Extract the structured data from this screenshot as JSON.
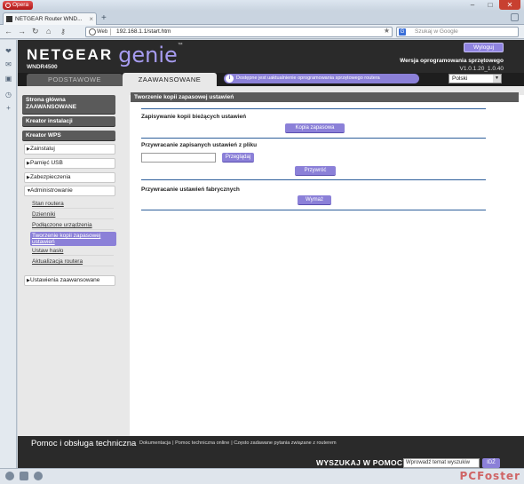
{
  "browser": {
    "app_button": "Opera",
    "tab_title": "NETGEAR Router WND...",
    "web_badge": "Web",
    "url": "192.168.1.1/start.htm",
    "search_placeholder": "Szukaj w Google"
  },
  "header": {
    "brand": "NETGEAR",
    "product": "genie",
    "model": "WNDR4500",
    "logout": "Wyloguj",
    "firmware_label": "Wersja oprogramowania sprzętowego",
    "firmware_version": "V1.0.1.20_1.0.40"
  },
  "tabs": {
    "basic": "PODSTAWOWE",
    "advanced": "ZAAWANSOWANE",
    "update_notice": "Dostępne jest uaktualnienie oprogramowania sprzętowego routera",
    "language": "Polski"
  },
  "nav": {
    "home": "Strona główna ZAAWANSOWANE",
    "setup_wizard": "Kreator instalacji",
    "wps_wizard": "Kreator WPS",
    "setup": "Zainstaluj",
    "usb_storage": "Pamięć USB",
    "security": "Zabezpieczenia",
    "administration": "Administrowanie",
    "sub": {
      "router_status": "Stan routera",
      "logs": "Dzienniki",
      "attached_devices": "Podłączone urządzenia",
      "backup": "Tworzenie kopii zapasowej ustawień",
      "set_password": "Ustaw hasło",
      "router_update": "Aktualizacja routera"
    },
    "advanced_setup": "Ustawienia zaawansowane"
  },
  "content": {
    "title": "Tworzenie kopii zapasowej ustawień",
    "save_label": "Zapisywanie kopii bieżących ustawień",
    "backup_button": "Kopia zapasowa",
    "restore_label": "Przywracanie zapisanych ustawień z pliku",
    "browse_button": "Przeglądaj",
    "restore_button": "Przywróć",
    "factory_label": "Przywracanie ustawień fabrycznych",
    "erase_button": "Wymaż"
  },
  "footer": {
    "help_title": "Pomoc i obsługa techniczna",
    "links": [
      "Dokumentacja",
      "Pomoc techniczna online",
      "Często zadawane pytania związane z routerem"
    ],
    "search_label": "WYSZUKAJ W POMOCY",
    "search_placeholder": "Wprowadź temat wyszukiw",
    "search_button": "IDŹ"
  },
  "watermark": "PCFoster"
}
